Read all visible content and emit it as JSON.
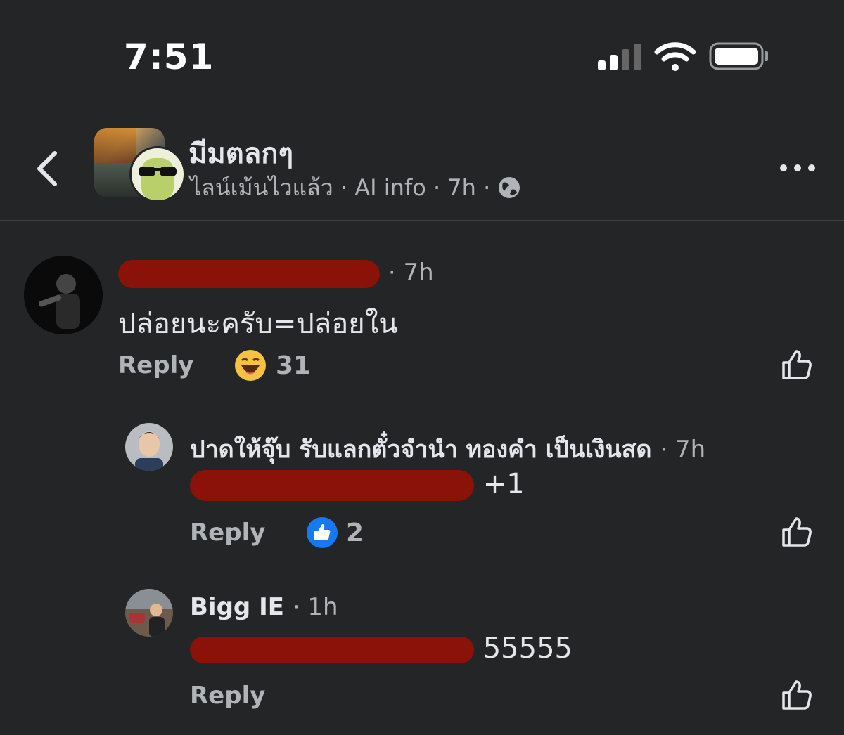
{
  "status_bar": {
    "time": "7:51"
  },
  "header": {
    "page_title": "มีมตลกๆ",
    "page_subtitle": "ไลน์เม้นไวแล้ว",
    "ai_info": "AI info",
    "time_ago": "7h",
    "separator": "·"
  },
  "comments": [
    {
      "author": "",
      "time": "· 7h",
      "text": "ปล่อยนะครับ=ปล่อยใน",
      "reply_label": "Reply",
      "reaction_icon": "haha-emoji",
      "reaction_count": "31"
    },
    {
      "author": "ปาดให้จุ๊บ รับแลกตั๋วจำนำ ทองคำ เป็นเงินสด",
      "time": "· 7h",
      "mention": "",
      "text": "+1",
      "reply_label": "Reply",
      "reaction_icon": "like-icon",
      "reaction_count": "2"
    },
    {
      "author": "Bigg IE",
      "time": "· 1h",
      "mention": "",
      "text": "55555",
      "reply_label": "Reply"
    }
  ],
  "colors": {
    "background": "#242526",
    "link": "#4599ff",
    "like_blue": "#1877f2",
    "muted": "#b0b3b8"
  }
}
